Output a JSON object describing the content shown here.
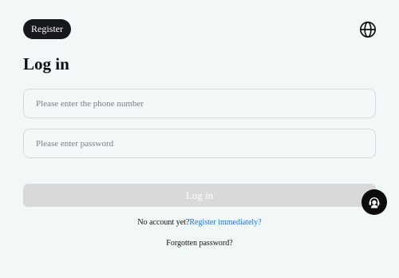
{
  "header": {
    "register_label": "Register",
    "language_icon": "globe-icon"
  },
  "form": {
    "title": "Log in",
    "phone_placeholder": "Please enter the phone number",
    "password_placeholder": "Please enter password",
    "login_label": "Log in"
  },
  "footer": {
    "no_account_text": "No account yet?",
    "register_link": "Register immediately?",
    "forgot_password": "Forgotten password?"
  },
  "support": {
    "icon": "customer-service-icon"
  },
  "colors": {
    "background": "#f2f7f7",
    "dark_button": "#16181c",
    "disabled_button": "#d9d9d9",
    "link": "#1f6fd1"
  }
}
